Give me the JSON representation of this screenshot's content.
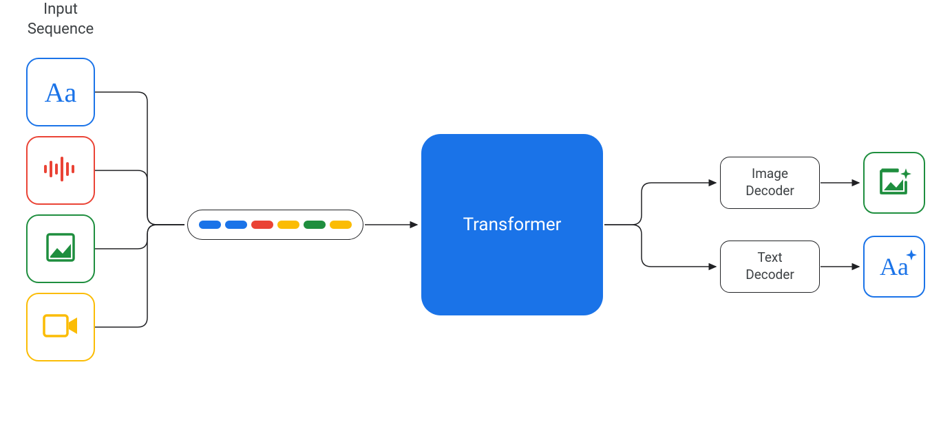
{
  "header": "Input\nSequence",
  "inputs": {
    "text": {
      "icon": "text-icon",
      "color": "#1a73e8",
      "label": "Aa"
    },
    "audio": {
      "icon": "audio-icon",
      "color": "#ea4335"
    },
    "image": {
      "icon": "image-icon",
      "color": "#1e8e3e"
    },
    "video": {
      "icon": "video-icon",
      "color": "#fbbc04"
    }
  },
  "tokens": [
    "blue",
    "blue",
    "red",
    "yellow",
    "green",
    "yellow"
  ],
  "transformer": {
    "label": "Transformer"
  },
  "decoders": {
    "image": {
      "label": "Image\nDecoder"
    },
    "text": {
      "label": "Text\nDecoder"
    }
  },
  "outputs": {
    "image": {
      "icon": "image-sparkle-icon",
      "color": "#1e8e3e"
    },
    "text": {
      "icon": "text-sparkle-icon",
      "color": "#1a73e8",
      "label": "Aa"
    }
  },
  "colors": {
    "blue": "#1a73e8",
    "red": "#ea4335",
    "green": "#1e8e3e",
    "yellow": "#fbbc04",
    "dark": "#202124",
    "text": "#3c4043"
  }
}
